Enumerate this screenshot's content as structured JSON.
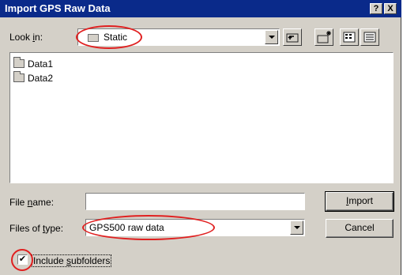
{
  "window": {
    "title": "Import GPS Raw Data",
    "help_label": "?",
    "close_label": "X"
  },
  "look_in": {
    "label_pre": "Look ",
    "label_accel": "i",
    "label_post": "n:",
    "value": "Static"
  },
  "toolbar": [
    "up-one-level-icon",
    "create-new-folder-icon",
    "list-view-icon",
    "details-view-icon"
  ],
  "files": [
    {
      "name": "Data1",
      "icon": "folder-icon"
    },
    {
      "name": "Data2",
      "icon": "folder-icon"
    }
  ],
  "file_name": {
    "label_pre": "File ",
    "label_accel": "n",
    "label_post": "ame:",
    "value": ""
  },
  "files_of_type": {
    "label_pre": "Files of ",
    "label_accel": "t",
    "label_post": "ype:",
    "value": "GPS500 raw data"
  },
  "buttons": {
    "import_accel": "I",
    "import_rest": "mport",
    "cancel": "Cancel"
  },
  "include_subfolders": {
    "checked": true,
    "check_mark": "✔",
    "label_pre": "Include ",
    "label_accel": "s",
    "label_post": "ubfolders"
  },
  "colors": {
    "titlebar": "#0a2a8a",
    "dialog": "#d4d0c8",
    "highlight_ring": "#e02020"
  }
}
